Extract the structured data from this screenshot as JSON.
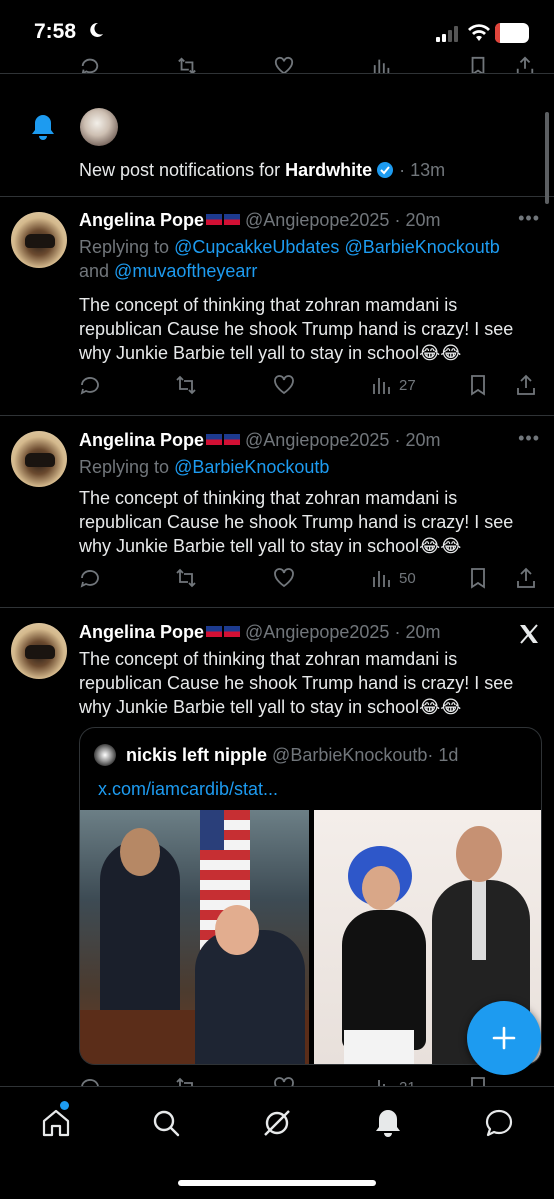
{
  "status_bar": {
    "time": "7:58",
    "battery": "16",
    "battery_level": 0.16
  },
  "notification": {
    "text_prefix": "New post notifications for ",
    "account_name": "Hardwhite",
    "time": "· 13m"
  },
  "tweets": [
    {
      "name": "Angelina Pope",
      "handle": "@Angiepope2025",
      "time": "· 20m",
      "replying_to_label": "Replying to ",
      "replying_links": [
        "@CupcakkeUbdates",
        "@BarbieKnockoutb"
      ],
      "replying_and": "and ",
      "replying_link3": "@muvaoftheyearr",
      "text": "The concept of thinking that zohran mamdani is republican Cause he shook Trump hand is crazy! I see why Junkie Barbie tell yall to stay in school😂😂",
      "views": "27"
    },
    {
      "name": "Angelina Pope",
      "handle": "@Angiepope2025",
      "time": "· 20m",
      "replying_to_label": "Replying to ",
      "replying_links": [
        "@BarbieKnockoutb"
      ],
      "text": "The concept of thinking that zohran mamdani is republican Cause he shook Trump hand is crazy! I see why Junkie Barbie tell yall to stay in school😂😂",
      "views": "50"
    },
    {
      "name": "Angelina Pope",
      "handle": "@Angiepope2025",
      "time": "· 20m",
      "text": "The concept of thinking that zohran mamdani is republican Cause he shook Trump hand is crazy! I see why Junkie Barbie tell yall to stay in school😂😂",
      "quote": {
        "name": "nickis left nipple",
        "handle": "@BarbieKnockoutb",
        "time": "· 1d",
        "link": "x.com/iamcardib/stat..."
      },
      "views": "21"
    }
  ],
  "icons": {
    "reply": "reply-icon",
    "repost": "repost-icon",
    "like": "like-icon",
    "views": "views-icon",
    "bookmark": "bookmark-icon",
    "share": "share-icon"
  },
  "colors": {
    "accent": "#1d9bf0",
    "background": "#000000",
    "muted": "#71767b"
  }
}
